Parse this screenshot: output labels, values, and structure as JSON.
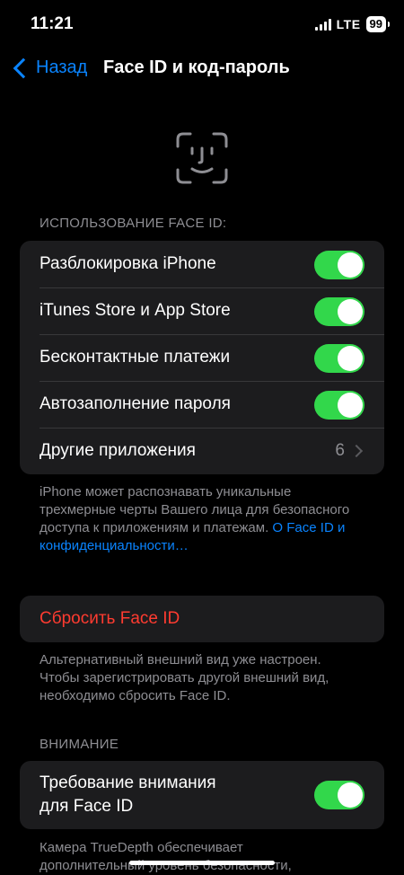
{
  "status_bar": {
    "time": "11:21",
    "network": "LTE",
    "battery": "99"
  },
  "nav": {
    "back_label": "Назад",
    "title": "Face ID и код-пароль"
  },
  "use_section": {
    "header": "ИСПОЛЬЗОВАНИЕ FACE ID:",
    "items": [
      {
        "label": "Разблокировка iPhone",
        "on": true
      },
      {
        "label": "iTunes Store и App Store",
        "on": true
      },
      {
        "label": "Бесконтактные платежи",
        "on": true
      },
      {
        "label": "Автозаполнение пароля",
        "on": true
      }
    ],
    "other_apps": {
      "label": "Другие приложения",
      "value": "6"
    },
    "footer_text": "iPhone может распознавать уникальные трехмерные черты Вашего лица для безопасного доступа к приложениям и платежам. ",
    "footer_link": "О Face ID и конфиденциальности…"
  },
  "reset": {
    "label": "Сбросить Face ID",
    "footer": "Альтернативный внешний вид уже настроен. Чтобы зарегистрировать другой внешний вид, необходимо сбросить Face ID."
  },
  "attention": {
    "header": "ВНИМАНИЕ",
    "item_line1": "Требование внимания",
    "item_line2": "для Face ID",
    "on": true,
    "footer_line1": "Камера TrueDepth обеспечивает",
    "footer_line2": "дополнительный уровень безопасности,"
  },
  "colors": {
    "accent": "#0a84ff",
    "toggle_on": "#32d74b",
    "destructive": "#ff3b30",
    "group_bg": "#1c1c1e"
  }
}
